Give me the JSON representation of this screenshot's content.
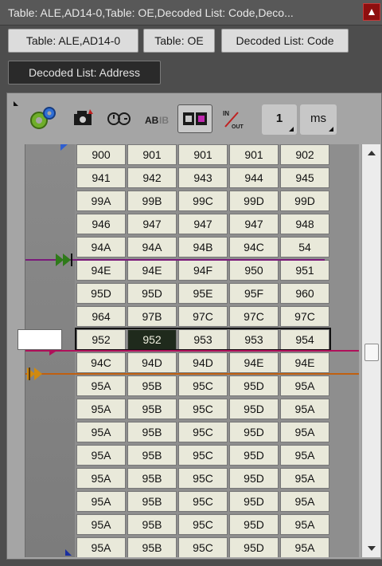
{
  "window": {
    "title": "Table: ALE,AD14-0,Table: OE,Decoded List: Code,Deco..."
  },
  "tabs": [
    {
      "label": "Table: ALE,AD14-0",
      "selected": false
    },
    {
      "label": "Table: OE",
      "selected": false
    },
    {
      "label": "Decoded List: Code",
      "selected": false
    },
    {
      "label": "Decoded List: Address",
      "selected": true
    }
  ],
  "toolbar": {
    "icons": [
      "settings-gear-icon",
      "camera-icon",
      "clock-sync-icon",
      "ab-compare-icon",
      "display-mode-icon",
      "in-out-icon"
    ],
    "count_value": "1",
    "unit_value": "ms"
  },
  "colors": {
    "cursor_purple": "#7a1a7a",
    "marker_green": "#2f7a1a",
    "cursor_magenta": "#b0105a",
    "marker_orange": "#c06010",
    "current_cell": "#1f2a1c"
  },
  "table": {
    "rows": [
      [
        "900",
        "901",
        "901",
        "901",
        "902"
      ],
      [
        "941",
        "942",
        "943",
        "944",
        "945"
      ],
      [
        "99A",
        "99B",
        "99C",
        "99D",
        "99D"
      ],
      [
        "946",
        "947",
        "947",
        "947",
        "948"
      ],
      [
        "94A",
        "94A",
        "94B",
        "94C",
        "54"
      ],
      [
        "94E",
        "94E",
        "94F",
        "950",
        "951"
      ],
      [
        "95D",
        "95D",
        "95E",
        "95F",
        "960"
      ],
      [
        "964",
        "97B",
        "97C",
        "97C",
        "97C"
      ],
      [
        "952",
        "952",
        "953",
        "953",
        "954"
      ],
      [
        "94C",
        "94D",
        "94D",
        "94E",
        "94E"
      ],
      [
        "95A",
        "95B",
        "95C",
        "95D",
        "95A"
      ],
      [
        "95A",
        "95B",
        "95C",
        "95D",
        "95A"
      ],
      [
        "95A",
        "95B",
        "95C",
        "95D",
        "95A"
      ],
      [
        "95A",
        "95B",
        "95C",
        "95D",
        "95A"
      ],
      [
        "95A",
        "95B",
        "95C",
        "95D",
        "95A"
      ],
      [
        "95A",
        "95B",
        "95C",
        "95D",
        "95A"
      ],
      [
        "95A",
        "95B",
        "95C",
        "95D",
        "95A"
      ],
      [
        "95A",
        "95B",
        "95C",
        "95D",
        "95A"
      ]
    ],
    "current_row": 8,
    "current_col": 1
  }
}
